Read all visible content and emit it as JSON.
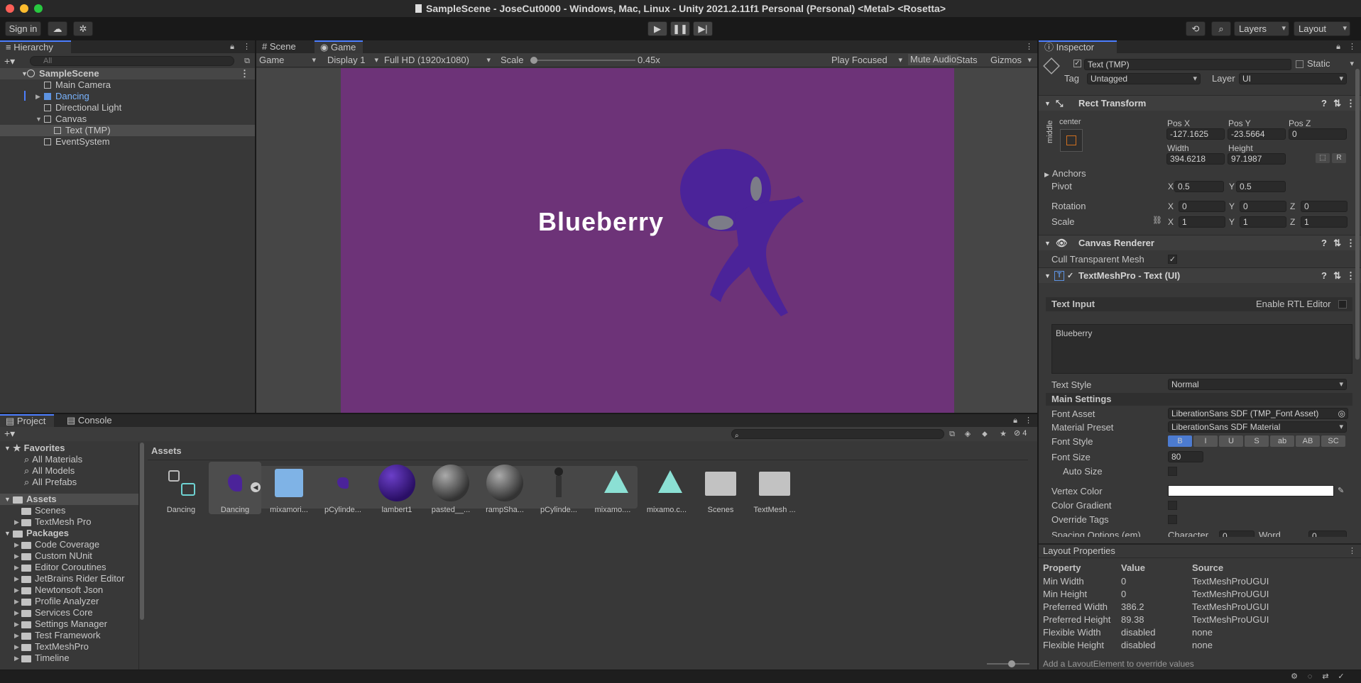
{
  "window": {
    "title": "SampleScene - JoseCut0000 - Windows, Mac, Linux - Unity 2021.2.11f1 Personal (Personal) <Metal> <Rosetta>"
  },
  "toolbar": {
    "sign_in": "Sign in",
    "layers": "Layers",
    "layout": "Layout"
  },
  "hierarchy": {
    "tab": "Hierarchy",
    "search_placeholder": "All",
    "items": [
      {
        "label": "SampleScene"
      },
      {
        "label": "Main Camera"
      },
      {
        "label": "Dancing"
      },
      {
        "label": "Directional Light"
      },
      {
        "label": "Canvas"
      },
      {
        "label": "Text (TMP)"
      },
      {
        "label": "EventSystem"
      }
    ]
  },
  "game": {
    "tabs": [
      "Scene",
      "Game"
    ],
    "mode": "Game",
    "display": "Display 1",
    "resolution": "Full HD (1920x1080)",
    "scale_label": "Scale",
    "scale_value": "0.45x",
    "play_focused": "Play Focused",
    "mute_audio": "Mute Audio",
    "stats": "Stats",
    "gizmos": "Gizmos",
    "canvas_text": "Blueberry",
    "bg_color": "#6d3378",
    "character_color": "#4b2399"
  },
  "inspector": {
    "tab": "Inspector",
    "object_name": "Text (TMP)",
    "static": "Static",
    "tag_label": "Tag",
    "tag": "Untagged",
    "layer_label": "Layer",
    "layer": "UI",
    "rect_transform": {
      "title": "Rect Transform",
      "anchor_h": "center",
      "anchor_v": "middle",
      "pos_x_label": "Pos X",
      "pos_x": "-127.1625",
      "pos_y_label": "Pos Y",
      "pos_y": "-23.5664",
      "pos_z_label": "Pos Z",
      "pos_z": "0",
      "width_label": "Width",
      "width": "394.6218",
      "height_label": "Height",
      "height": "97.1987",
      "anchors": "Anchors",
      "pivot": "Pivot",
      "pivot_x": "0.5",
      "pivot_y": "0.5",
      "rotation": "Rotation",
      "rot_x": "0",
      "rot_y": "0",
      "rot_z": "0",
      "scale": "Scale",
      "scale_x": "1",
      "scale_y": "1",
      "scale_z": "1",
      "x": "X",
      "y": "Y",
      "z": "Z",
      "r": "R"
    },
    "canvas_renderer": {
      "title": "Canvas Renderer",
      "cull": "Cull Transparent Mesh"
    },
    "tmp": {
      "title": "TextMeshPro - Text (UI)",
      "text_input": "Text Input",
      "rtl": "Enable RTL Editor",
      "text": "Blueberry",
      "text_style_label": "Text Style",
      "text_style": "Normal",
      "main_settings": "Main Settings",
      "font_asset_label": "Font Asset",
      "font_asset": "LiberationSans SDF (TMP_Font Asset)",
      "material_preset_label": "Material Preset",
      "material_preset": "LiberationSans SDF Material",
      "font_style_label": "Font Style",
      "font_styles": [
        "B",
        "I",
        "U",
        "S",
        "ab",
        "AB",
        "SC"
      ],
      "font_size_label": "Font Size",
      "font_size": "80",
      "auto_size": "Auto Size",
      "vertex_color": "Vertex Color",
      "color_gradient": "Color Gradient",
      "override_tags": "Override Tags",
      "spacing": "Spacing Options (em)",
      "character": "Character",
      "character_val": "0",
      "word": "Word",
      "word_val": "0"
    }
  },
  "layout_props": {
    "title": "Layout Properties",
    "headers": [
      "Property",
      "Value",
      "Source"
    ],
    "rows": [
      [
        "Min Width",
        "0",
        "TextMeshProUGUI"
      ],
      [
        "Min Height",
        "0",
        "TextMeshProUGUI"
      ],
      [
        "Preferred Width",
        "386.2",
        "TextMeshProUGUI"
      ],
      [
        "Preferred Height",
        "89.38",
        "TextMeshProUGUI"
      ],
      [
        "Flexible Width",
        "disabled",
        "none"
      ],
      [
        "Flexible Height",
        "disabled",
        "none"
      ]
    ],
    "footer": "Add a LayoutElement to override values"
  },
  "project": {
    "tabs": [
      "Project",
      "Console"
    ],
    "hidden_count": "4",
    "favorites": "Favorites",
    "fav_items": [
      "All Materials",
      "All Models",
      "All Prefabs"
    ],
    "assets": "Assets",
    "asset_folders": [
      "Scenes",
      "TextMesh Pro"
    ],
    "packages": "Packages",
    "package_items": [
      "Code Coverage",
      "Custom NUnit",
      "Editor Coroutines",
      "JetBrains Rider Editor",
      "Newtonsoft Json",
      "Profile Analyzer",
      "Services Core",
      "Settings Manager",
      "Test Framework",
      "TextMeshPro",
      "Timeline"
    ],
    "breadcrumb": "Assets",
    "grid": [
      "Dancing",
      "Dancing",
      "mixamori...",
      "pCylinde...",
      "lambert1",
      "pasted__...",
      "rampSha...",
      "pCylinde...",
      "mixamo....",
      "mixamo.c...",
      "Scenes",
      "TextMesh ..."
    ]
  }
}
